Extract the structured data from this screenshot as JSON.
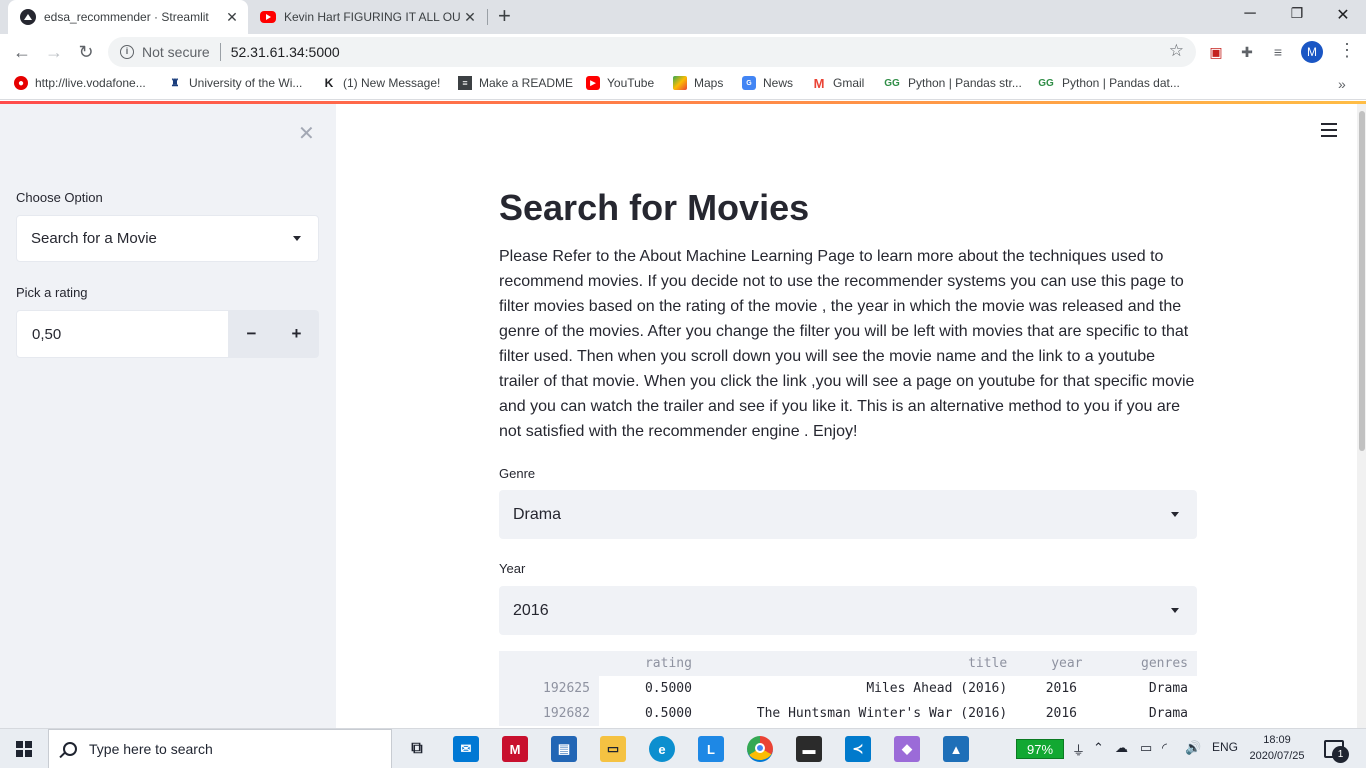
{
  "browser": {
    "tabs": [
      {
        "title": "edsa_recommender · Streamlit",
        "icon": "streamlit-icon"
      },
      {
        "title": "Kevin Hart FIGURING IT ALL OUT",
        "icon": "youtube-icon"
      }
    ],
    "address": {
      "security": "Not secure",
      "url": "52.31.61.34:5000"
    },
    "profile_initial": "M",
    "bookmarks": [
      {
        "label": "http://live.vodafone...",
        "icon": "vodafone-icon"
      },
      {
        "label": "University of the Wi...",
        "icon": "university-crest-icon"
      },
      {
        "label": "(1) New Message!",
        "icon": "klout-icon"
      },
      {
        "label": "Make a README",
        "icon": "document-icon"
      },
      {
        "label": "YouTube",
        "icon": "youtube-icon"
      },
      {
        "label": "Maps",
        "icon": "maps-icon"
      },
      {
        "label": "News",
        "icon": "news-icon"
      },
      {
        "label": "Gmail",
        "icon": "gmail-icon"
      },
      {
        "label": "Python | Pandas str...",
        "icon": "geeksforgeeks-icon"
      },
      {
        "label": "Python | Pandas dat...",
        "icon": "geeksforgeeks-icon"
      }
    ]
  },
  "sidebar": {
    "choose_label": "Choose Option",
    "choose_value": "Search for a Movie",
    "rating_label": "Pick a rating",
    "rating_value": "0,50",
    "minus": "−",
    "plus": "+"
  },
  "main": {
    "title": "Search for Movies",
    "intro": "Please Refer to the About Machine Learning Page to learn more about the techniques used to recommend movies. If you decide not to use the recommender systems you can use this page to filter movies based on the rating of the movie , the year in which the movie was released and the genre of the movies. After you change the filter you will be left with movies that are specific to that filter used. Then when you scroll down you will see the movie name and the link to a youtube trailer of that movie. When you click the link ,you will see a page on youtube for that specific movie and you can watch the trailer and see if you like it. This is an alternative method to you if you are not satisfied with the recommender engine . Enjoy!",
    "genre_label": "Genre",
    "genre_value": "Drama",
    "year_label": "Year",
    "year_value": "2016",
    "table": {
      "columns": [
        "",
        "rating",
        "title",
        "year",
        "genres"
      ],
      "rows": [
        {
          "index": "192625",
          "rating": "0.5000",
          "title": "Miles Ahead (2016)",
          "year": "2016",
          "genres": "Drama"
        },
        {
          "index": "192682",
          "rating": "0.5000",
          "title": "The Huntsman Winter's War (2016)",
          "year": "2016",
          "genres": "Drama"
        }
      ]
    }
  },
  "taskbar": {
    "search_placeholder": "Type here to search",
    "battery": "97%",
    "language": "ENG",
    "time": "18:09",
    "date": "2020/07/25",
    "notification_count": "1"
  },
  "colors": {
    "accent_gradient_start": "#ff4b4b",
    "accent_gradient_end": "#ffbd45",
    "sidebar_bg": "#f0f2f6",
    "text": "#262730"
  }
}
